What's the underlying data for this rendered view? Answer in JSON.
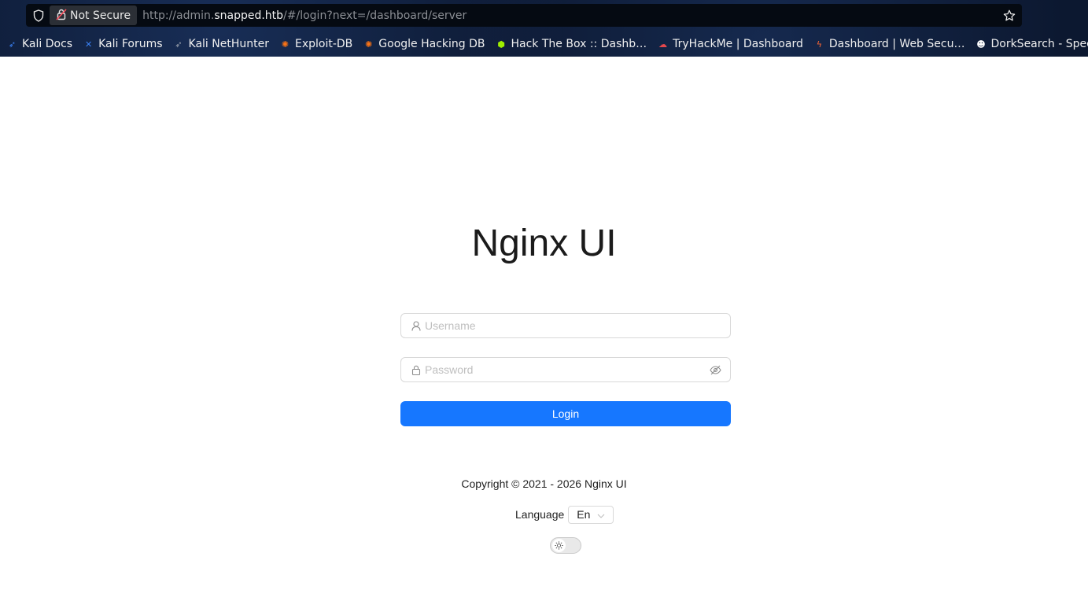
{
  "browser": {
    "security_label": "Not Secure",
    "url_prefix": "http://admin.",
    "url_host": "snapped.htb",
    "url_path": "/#/login?next=/dashboard/server",
    "bookmarks": [
      {
        "label": "Kali Docs",
        "icon": "kali-dragon-icon",
        "color": "#3b82f6"
      },
      {
        "label": "Kali Forums",
        "icon": "kali-forums-icon",
        "color": "#3b82f6"
      },
      {
        "label": "Kali NetHunter",
        "icon": "kali-dragon-icon",
        "color": "#9ca3af"
      },
      {
        "label": "Exploit-DB",
        "icon": "exploit-db-icon",
        "color": "#f97316"
      },
      {
        "label": "Google Hacking DB",
        "icon": "exploit-db-icon",
        "color": "#f97316"
      },
      {
        "label": "Hack The Box :: Dashb…",
        "icon": "htb-cube-icon",
        "color": "#9fef00"
      },
      {
        "label": "TryHackMe | Dashboard",
        "icon": "thm-icon",
        "color": "#e5484d"
      },
      {
        "label": "Dashboard | Web Secu…",
        "icon": "portswigger-icon",
        "color": "#ff6633"
      },
      {
        "label": "DorkSearch - Speed u…",
        "icon": "dorksearch-icon",
        "color": "#ffffff"
      }
    ]
  },
  "login": {
    "title": "Nginx UI",
    "username_placeholder": "Username",
    "password_placeholder": "Password",
    "login_label": "Login",
    "accent_color": "#1677ff"
  },
  "footer": {
    "copyright": "Copyright © 2021 - 2026 Nginx UI",
    "language_label": "Language",
    "language_value": "En",
    "theme_toggle_icon": "sun-icon"
  }
}
